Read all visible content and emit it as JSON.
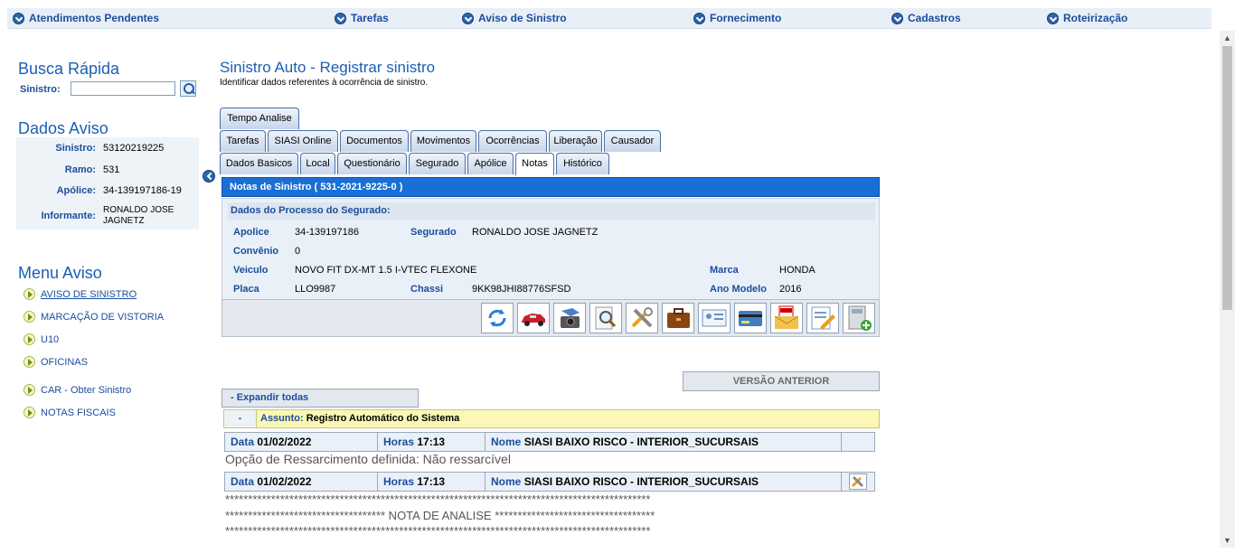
{
  "topnav": {
    "items": [
      {
        "label": "Atendimentos Pendentes"
      },
      {
        "label": "Tarefas"
      },
      {
        "label": "Aviso de Sinistro"
      },
      {
        "label": "Fornecimento"
      },
      {
        "label": "Cadastros"
      },
      {
        "label": "Roteirização"
      }
    ]
  },
  "busca": {
    "title": "Busca Rápida",
    "label": "Sinistro:",
    "value": ""
  },
  "dados_aviso": {
    "title": "Dados Aviso",
    "rows": [
      {
        "k": "Sinistro:",
        "v": "53120219225"
      },
      {
        "k": "Ramo:",
        "v": "531"
      },
      {
        "k": "Apólice:",
        "v": "34-139197186-19"
      },
      {
        "k": "Informante:",
        "v": "RONALDO JOSE JAGNETZ"
      }
    ]
  },
  "menu_aviso": {
    "title": "Menu Aviso",
    "items": [
      {
        "label": "AVISO DE SINISTRO"
      },
      {
        "label": "MARCAÇÃO DE VISTORIA"
      },
      {
        "label": "U10"
      },
      {
        "label": "OFICINAS"
      },
      {
        "label": "CAR - Obter Sinistro"
      },
      {
        "label": "NOTAS FISCAIS"
      }
    ]
  },
  "page": {
    "title": "Sinistro Auto - Registrar sinistro",
    "subtitle": "Identificar dados referentes à ocorrência de sinistro."
  },
  "tabs": {
    "row1": [
      "Tempo Analise"
    ],
    "row2": [
      "Tarefas",
      "SIASI Online",
      "Documentos",
      "Movimentos",
      "Ocorrências",
      "Liberação",
      "Causador"
    ],
    "row3": [
      "Dados Basicos",
      "Local",
      "Questionário",
      "Segurado",
      "Apólice",
      "Notas",
      "Histórico"
    ],
    "active": "Notas"
  },
  "notas": {
    "bar": "Notas de Sinistro  (   531-2021-9225-0   )",
    "section": "Dados do Processo do Segurado:",
    "fields": {
      "apolice_label": "Apolice",
      "apolice": "34-139197186",
      "segurado_label": "Segurado",
      "segurado": "RONALDO JOSE JAGNETZ",
      "convenio_label": "Convênio",
      "convenio": "0",
      "veiculo_label": "Veiculo",
      "veiculo": "NOVO FIT DX-MT 1.5 I-VTEC FLEXONE",
      "marca_label": "Marca",
      "marca": "HONDA",
      "placa_label": "Placa",
      "placa": "LLO9987",
      "chassi_label": "Chassi",
      "chassi": "9KK98JHI88776SFSD",
      "ano_label": "Ano Modelo",
      "ano": "2016"
    },
    "toolbar_icons": [
      "refresh-icon",
      "car-icon",
      "camera-icon",
      "magnify-document-icon",
      "tools-icon",
      "briefcase-icon",
      "id-card-icon",
      "credit-card-icon",
      "pdf-mail-icon",
      "edit-document-icon",
      "calculator-add-icon"
    ]
  },
  "versao_anterior": "VERSÃO ANTERIOR",
  "expandir": "-  Expandir todas",
  "assunto": {
    "minus": "-",
    "label": "Assunto:",
    "value": "Registro Automático do Sistema"
  },
  "entries": [
    {
      "data_label": "Data",
      "data": "01/02/2022",
      "horas_label": "Horas",
      "horas": "17:13",
      "nome_label": "Nome",
      "nome": "SIASI BAIXO RISCO - INTERIOR_SUCURSAIS",
      "text": "Opção de Ressarcimento definida: Não ressarcível"
    },
    {
      "data_label": "Data",
      "data": "01/02/2022",
      "horas_label": "Horas",
      "horas": "17:13",
      "nome_label": "Nome",
      "nome": "SIASI BAIXO RISCO - INTERIOR_SUCURSAIS",
      "line1": "*********************************************************************************************",
      "line2": "***********************************  NOTA DE ANALISE  ***********************************",
      "line3": "*********************************************************************************************"
    }
  ]
}
